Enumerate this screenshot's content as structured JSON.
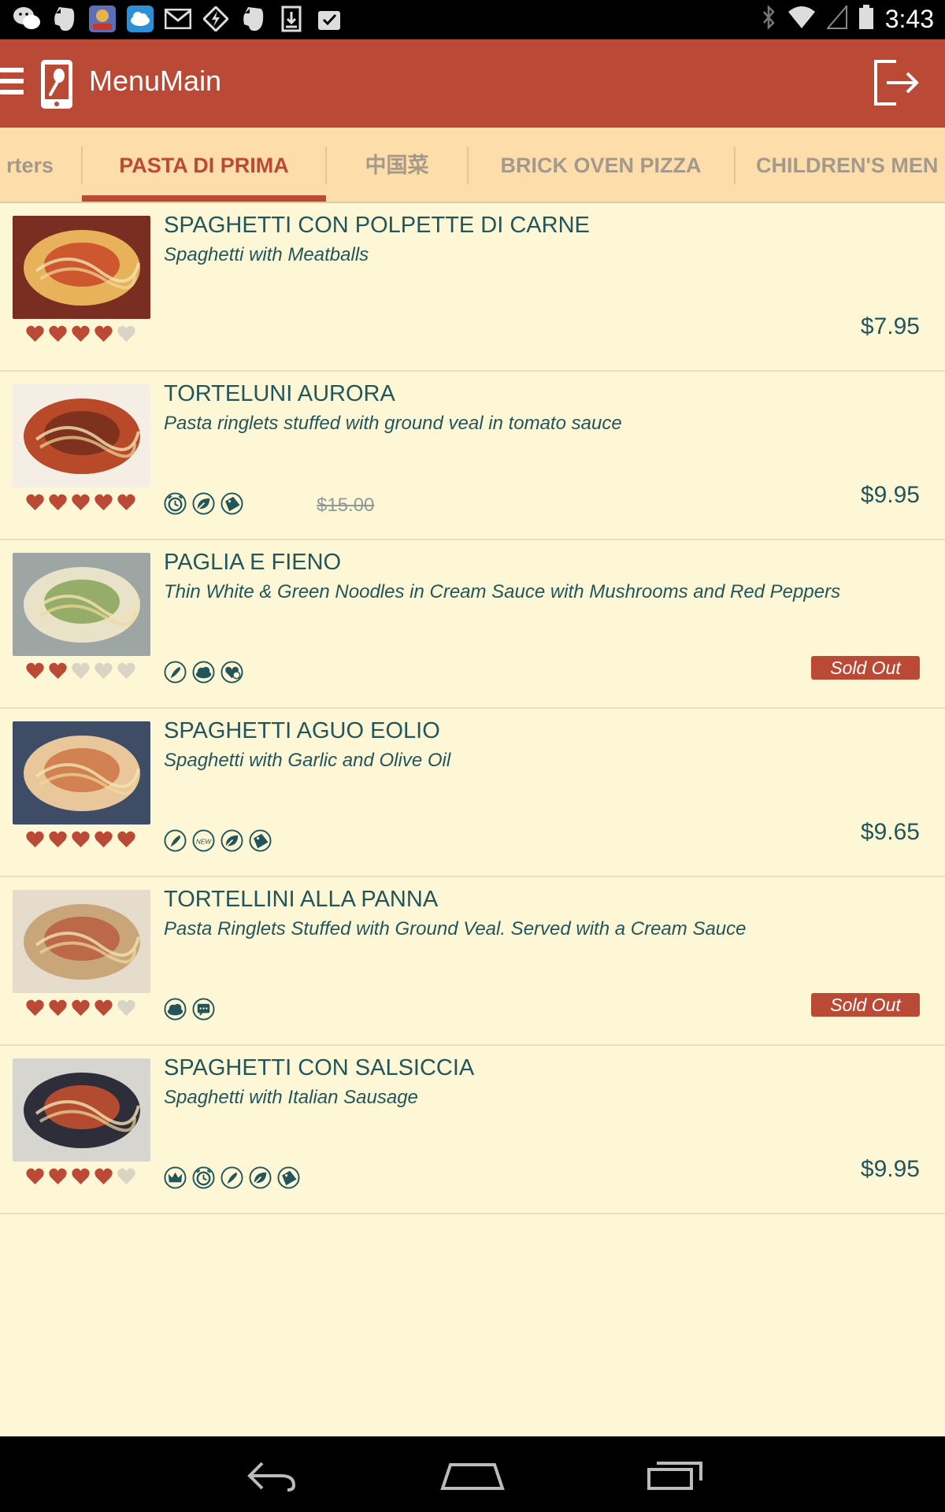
{
  "status_bar": {
    "time": "3:43",
    "left_icons": [
      "wechat-icon",
      "evernote-icon",
      "game-app-icon",
      "cloud-app-icon",
      "gmail-icon",
      "bolt-icon",
      "evernote-icon",
      "download-icon",
      "clipboard-check-icon"
    ],
    "right_icons": [
      "bluetooth-icon",
      "wifi-icon",
      "signal-icon",
      "battery-icon"
    ]
  },
  "app_bar": {
    "title": "MenuMain",
    "menu_icon": "hamburger-icon",
    "logo_icon": "menu-app-logo-icon",
    "action_icon": "logout-icon"
  },
  "tabs": [
    {
      "label": "rters",
      "active": false
    },
    {
      "label": "PASTA DI PRIMA",
      "active": true
    },
    {
      "label": "中国菜",
      "active": false
    },
    {
      "label": "BRICK OVEN PIZZA",
      "active": false
    },
    {
      "label": "CHILDREN'S MEN",
      "active": false
    }
  ],
  "items": [
    {
      "name": "SPAGHETTI CON POLPETTE DI CARNE",
      "description": "Spaghetti  with Meatballs",
      "rating": 4,
      "features": [],
      "old_price": "",
      "price": "$7.95",
      "sold_out": false,
      "thumb_colors": [
        "#7A2E22",
        "#E8B25A",
        "#C43A22"
      ]
    },
    {
      "name": "TORTELUNI AURORA",
      "description": "Pasta ringlets stuffed with ground veal in tomato sauce",
      "rating": 5,
      "features": [
        "alarm-clock-icon",
        "leaf-icon",
        "sale-tag-icon"
      ],
      "old_price": "$15.00",
      "price": "$9.95",
      "sold_out": false,
      "thumb_colors": [
        "#F4EEE4",
        "#B84A2A",
        "#6B2A1A"
      ]
    },
    {
      "name": "PAGLIA E FIENO",
      "description": "Thin White & Green Noodles in Cream Sauce with Mushrooms and Red Peppers",
      "rating": 2,
      "features": [
        "chili-icon",
        "cloud-icon",
        "heart-plus-icon"
      ],
      "old_price": "",
      "price": "",
      "sold_out": true,
      "sold_out_label": "Sold Out",
      "thumb_colors": [
        "#9EA6A4",
        "#E8E3C8",
        "#7B9A4A"
      ]
    },
    {
      "name": "SPAGHETTI AGUO EOLIO",
      "description": "Spaghetti with Garlic and Olive Oil",
      "rating": 5,
      "features": [
        "chili-icon",
        "new-badge-icon",
        "leaf-icon",
        "sale-tag-icon"
      ],
      "old_price": "",
      "price": "$9.65",
      "sold_out": false,
      "thumb_colors": [
        "#3E4C66",
        "#E9C79A",
        "#C8693A"
      ]
    },
    {
      "name": "TORTELLINI ALLA PANNA",
      "description": "Pasta Ringlets Stuffed with Ground Veal. Served with a Cream Sauce",
      "rating": 4,
      "features": [
        "cloud-icon",
        "chat-icon"
      ],
      "old_price": "",
      "price": "",
      "sold_out": true,
      "sold_out_label": "Sold Out",
      "thumb_colors": [
        "#E6DCCC",
        "#C9A57A",
        "#B5563A"
      ]
    },
    {
      "name": "SPAGHETTI  CON SALSICCIA",
      "description": "Spaghetti with Italian Sausage",
      "rating": 4,
      "features": [
        "crown-icon",
        "alarm-clock-icon",
        "chili-icon",
        "leaf-icon",
        "sale-tag-icon"
      ],
      "old_price": "",
      "price": "$9.95",
      "sold_out": false,
      "thumb_colors": [
        "#D7D5CF",
        "#2E2E3A",
        "#E0552E"
      ]
    }
  ],
  "nav_bar": [
    "back-icon",
    "home-icon",
    "recent-apps-icon"
  ],
  "colors": {
    "brand": "#BA4A35",
    "tab_bar": "#FDDDAA",
    "background": "#FEF7D6",
    "text": "#22565C",
    "heart_on": "#BA4A35",
    "heart_off": "#D9D4C4"
  }
}
